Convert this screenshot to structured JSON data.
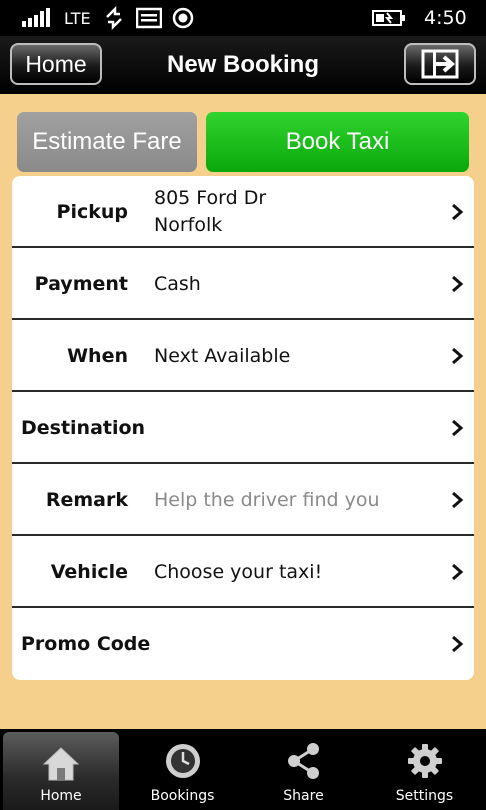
{
  "status_bar": {
    "network": "LTE",
    "time": "4:50"
  },
  "header": {
    "home_label": "Home",
    "title": "New Booking",
    "exit_icon": "logout-arrow-icon"
  },
  "actions": {
    "estimate_label": "Estimate Fare",
    "book_label": "Book Taxi"
  },
  "form": {
    "rows": [
      {
        "label": "Pickup",
        "value_line1": "805 Ford Dr",
        "value_line2": "Norfolk"
      },
      {
        "label": "Payment",
        "value_line1": "Cash"
      },
      {
        "label": "When",
        "value_line1": "Next Available"
      },
      {
        "label": "Destination",
        "value_line1": ""
      },
      {
        "label": "Remark",
        "placeholder": "Help the driver find you"
      },
      {
        "label": "Vehicle",
        "value_line1": "Choose your taxi!"
      },
      {
        "label": "Promo Code",
        "value_line1": ""
      }
    ]
  },
  "tabs": [
    {
      "label": "Home",
      "icon": "house-icon",
      "active": true
    },
    {
      "label": "Bookings",
      "icon": "clock-icon",
      "active": false
    },
    {
      "label": "Share",
      "icon": "share-icon",
      "active": false
    },
    {
      "label": "Settings",
      "icon": "gear-icon",
      "active": false
    }
  ],
  "colors": {
    "background": "#f5d08c",
    "book_button": "#16bb16",
    "estimate_button": "#949494"
  }
}
